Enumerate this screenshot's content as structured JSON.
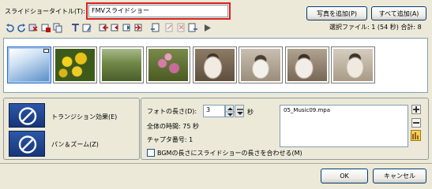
{
  "title_row": {
    "label": "スライドショータイトル(T):",
    "value": "FMVスライドショー",
    "add_photo_button": "写真を追加(P)",
    "add_all_button": "すべて追加(A)"
  },
  "selection_info": "選択ファイル: 1 (54 秒)  合計: 8",
  "thumbnails": [
    {
      "name": "sky",
      "colors": [
        "#5b8fc9",
        "#c9dced"
      ]
    },
    {
      "name": "yellow-flowers",
      "colors": [
        "#3d5a1a",
        "#e8c21a"
      ]
    },
    {
      "name": "garden",
      "colors": [
        "#4b5e2c",
        "#9cae7a"
      ]
    },
    {
      "name": "pink-flowers",
      "colors": [
        "#5a6a2f",
        "#c86a9a"
      ]
    },
    {
      "name": "cat-1",
      "colors": [
        "#6b5a46",
        "#d7cfc2"
      ]
    },
    {
      "name": "cat-2",
      "colors": [
        "#8a7a66",
        "#ece6dc"
      ]
    },
    {
      "name": "cat-3",
      "colors": [
        "#7a6a58",
        "#d9d1c4"
      ]
    }
  ],
  "effects": {
    "transition_label": "トランジション効果(E)",
    "pan_zoom_label": "パン＆ズーム(Z)"
  },
  "photo_settings": {
    "length_label": "フォトの長さ(D):",
    "length_value": "3",
    "length_unit": "秒",
    "total_time": "全体の時間: 75 秒",
    "chapter_number": "チャプタ番号: 1",
    "bgm_fit_label": "BGMの長さにスライドショーの長さを合わせる(M)"
  },
  "music": {
    "files": [
      "05_Music09.mpa"
    ]
  },
  "footer": {
    "ok_button": "OK",
    "cancel_button": "キャンセル"
  },
  "colors": {
    "highlight_red": "#e0201a",
    "thumb_selected": "#a6c8f0"
  }
}
